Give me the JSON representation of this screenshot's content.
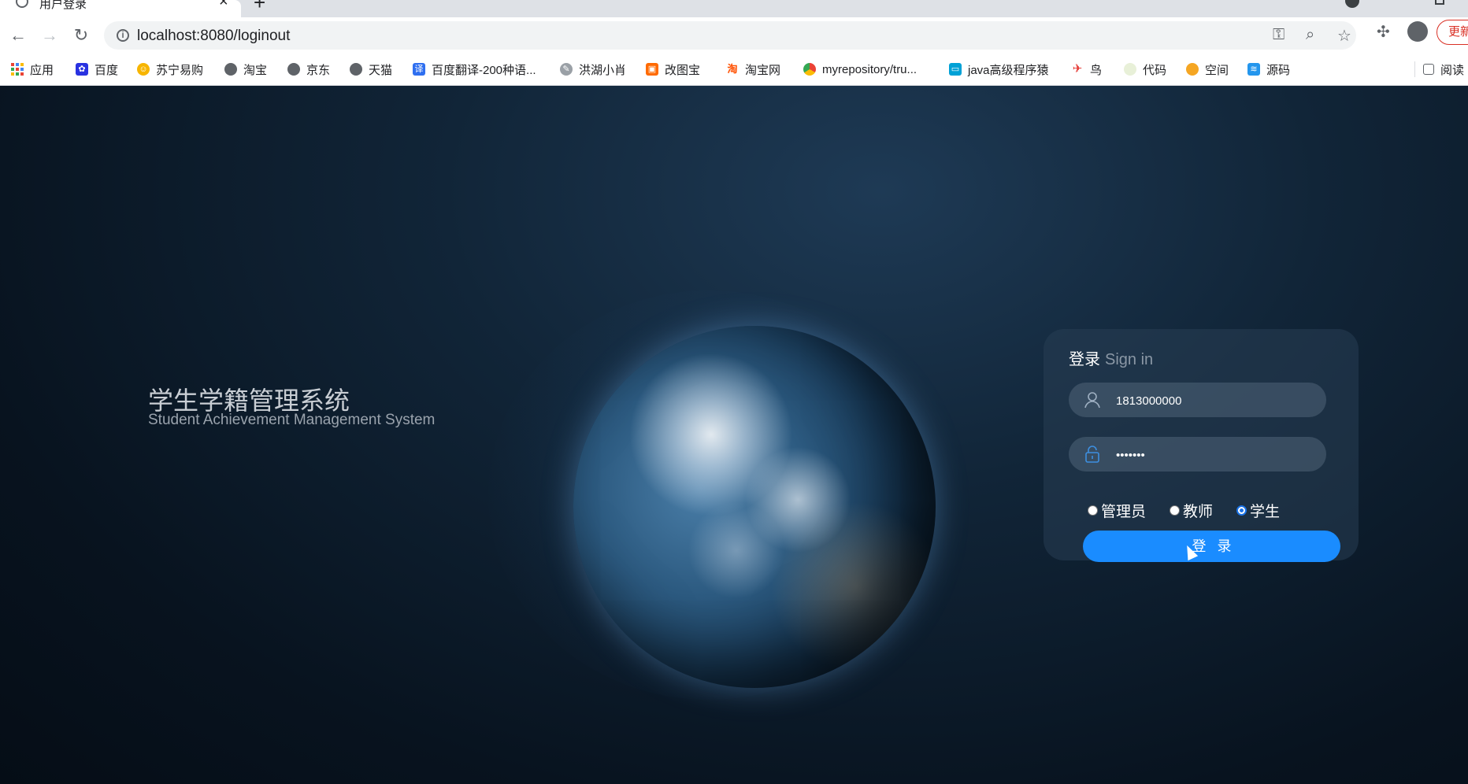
{
  "browser": {
    "tab_title": "用户登录",
    "url": "localhost:8080/loginout",
    "update_label": "更新",
    "bookmarks": [
      {
        "label": "应用",
        "icon": "apps-grid-icon"
      },
      {
        "label": "百度",
        "icon": "baidu-icon"
      },
      {
        "label": "苏宁易购",
        "icon": "suning-icon"
      },
      {
        "label": "淘宝",
        "icon": "globe-icon"
      },
      {
        "label": "京东",
        "icon": "globe-icon"
      },
      {
        "label": "天猫",
        "icon": "globe-icon"
      },
      {
        "label": "百度翻译-200种语...",
        "icon": "translate-icon"
      },
      {
        "label": "洪湖小肖",
        "icon": "bird-icon"
      },
      {
        "label": "改图宝",
        "icon": "gaitubao-icon"
      },
      {
        "label": "淘宝网",
        "icon": "taobao-icon"
      },
      {
        "label": "myrepository/tru...",
        "icon": "chrome-icon"
      },
      {
        "label": "java高级程序猿",
        "icon": "bilibili-icon"
      },
      {
        "label": "鸟",
        "icon": "bird-red-icon"
      },
      {
        "label": "代码",
        "icon": "code-icon"
      },
      {
        "label": "空间",
        "icon": "space-icon"
      },
      {
        "label": "源码",
        "icon": "docker-icon"
      }
    ],
    "reading_list_label": "阅读"
  },
  "page": {
    "title": "学生学籍管理系统",
    "subtitle": "Student Achievement Management System"
  },
  "login": {
    "heading": "登录",
    "heading_sub": "Sign in",
    "username": "1813000000",
    "password": "•••••••",
    "roles": [
      {
        "label": "管理员",
        "checked": false
      },
      {
        "label": "教师",
        "checked": false
      },
      {
        "label": "学生",
        "checked": true
      }
    ],
    "submit_label": "登录"
  },
  "colors": {
    "accent": "#1a8cff",
    "background": "#0b1a2a"
  }
}
